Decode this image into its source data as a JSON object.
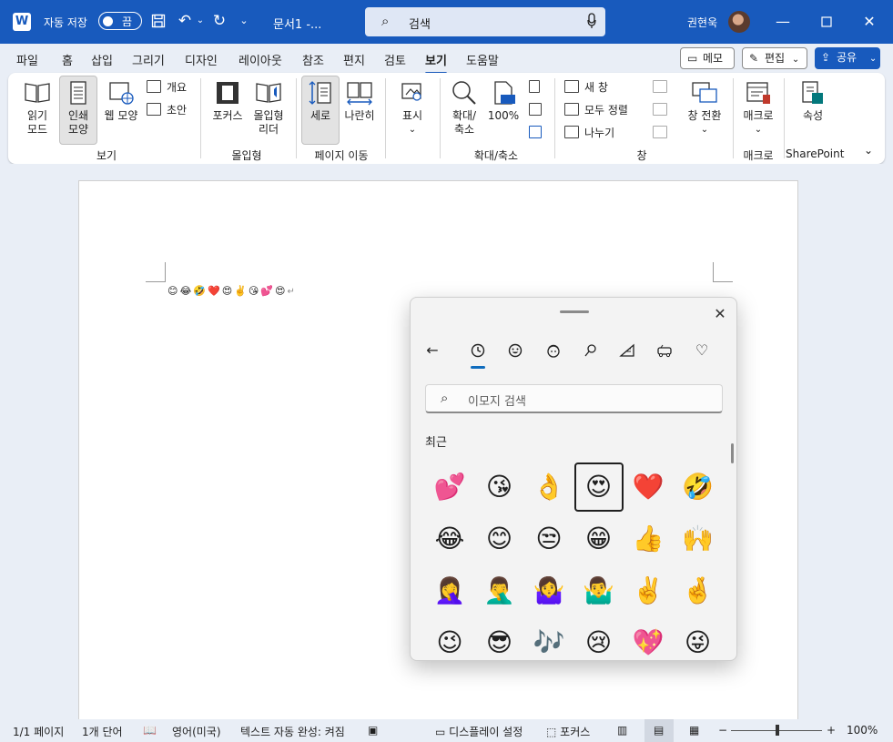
{
  "titlebar": {
    "app_logo": "W",
    "autosave_label": "자동 저장",
    "autosave_state": "끔",
    "doc_name": "문서1  -...",
    "search_text": "검색",
    "user_name": "권현욱",
    "icons": [
      "save-icon",
      "undo-icon",
      "redo-icon",
      "customize-icon",
      "minimize-icon",
      "maximize-icon",
      "close-icon"
    ]
  },
  "tabs": {
    "items": [
      "파일",
      "홈",
      "삽입",
      "그리기",
      "디자인",
      "레이아웃",
      "참조",
      "편지",
      "검토",
      "보기",
      "도움말"
    ],
    "active": "보기",
    "memo": "메모",
    "edit": "편집",
    "share": "공유"
  },
  "ribbon": {
    "view": {
      "read_mode": [
        "읽기",
        "모드"
      ],
      "print_layout": [
        "인쇄",
        "모양"
      ],
      "web_layout": "웹 모양",
      "outline": "개요",
      "draft": "초안",
      "group": "보기"
    },
    "immersive": {
      "focus": "포커스",
      "reader": [
        "몰입형",
        "리더"
      ],
      "group": "몰입형"
    },
    "page_move": {
      "vertical": "세로",
      "side_by_side": "나란히",
      "group": "페이지 이동"
    },
    "show": {
      "label": "표시"
    },
    "zoom": {
      "zoom": [
        "확대/",
        "축소"
      ],
      "percent": "100%",
      "group": "확대/축소"
    },
    "window": {
      "new_window": "새 창",
      "arrange_all": "모두 정렬",
      "split": "나누기",
      "switch": "창 전환",
      "group": "창"
    },
    "macro": {
      "label": "매크로",
      "group": "매크로"
    },
    "sharepoint": {
      "label": "속성",
      "group": "SharePoint"
    }
  },
  "document": {
    "content": "😊😂🤣❤️😍✌️😘💕😍",
    "para_mark": "↵"
  },
  "emoji_panel": {
    "search_placeholder": "이모지 검색",
    "section": "최근",
    "categories": [
      "back-icon",
      "recent-icon",
      "emoji-icon",
      "kaomoji-icon",
      "symbols-icon",
      "gif-icon",
      "clipboard-icon",
      "favorites-icon"
    ],
    "emojis": [
      [
        "💕",
        "😘",
        "👌",
        "😍",
        "❤️",
        "🤣"
      ],
      [
        "😂",
        "😊",
        "😒",
        "😁",
        "👍",
        "🙌"
      ],
      [
        "🤦‍♀️",
        "🤦‍♂️",
        "🤷‍♀️",
        "🤷‍♂️",
        "✌️",
        "🤞"
      ],
      [
        "😉",
        "😎",
        "🎶",
        "😢",
        "💖",
        "😜"
      ]
    ],
    "selected": "😍"
  },
  "statusbar": {
    "page": "1/1 페이지",
    "words": "1개 단어",
    "language": "영어(미국)",
    "autocomplete": "텍스트 자동 완성: 켜짐",
    "display": "디스플레이 설정",
    "focus": "포커스",
    "zoom": "100%",
    "minus": "−",
    "plus": "+"
  }
}
